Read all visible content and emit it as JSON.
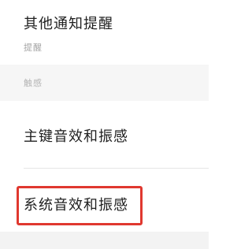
{
  "settings": {
    "other_notifications": {
      "title": "其他通知提醒",
      "subtitle": "提醒"
    },
    "haptics_section": {
      "header": "触感"
    },
    "key_sound_vibration": {
      "title": "主键音效和振感"
    },
    "system_sound_vibration": {
      "title": "系统音效和振感"
    }
  },
  "colors": {
    "highlight": "#e0382f",
    "section_background": "#f6f6f6"
  }
}
